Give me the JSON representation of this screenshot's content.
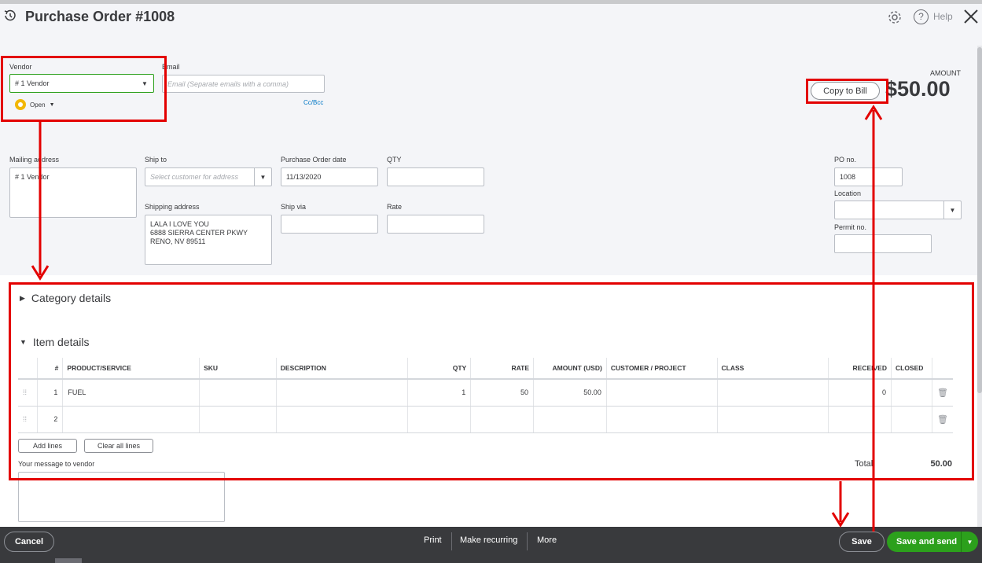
{
  "header": {
    "title": "Purchase Order #1008",
    "help_label": "Help",
    "amount_label": "AMOUNT",
    "amount_value": "$50.00",
    "copy_button": "Copy to Bill"
  },
  "vendor": {
    "label": "Vendor",
    "value": "# 1 Vendor",
    "status": "Open"
  },
  "email": {
    "label": "Email",
    "placeholder": "Email (Separate emails with a comma)",
    "cc_bcc": "Cc/Bcc"
  },
  "mailing": {
    "label": "Mailing address",
    "value": "# 1 Vendor"
  },
  "ship_to": {
    "label": "Ship to",
    "placeholder": "Select customer for address"
  },
  "shipping_address": {
    "label": "Shipping address",
    "value": "LALA I LOVE YOU\n6888 SIERRA CENTER PKWY\nRENO, NV  89511"
  },
  "po_date": {
    "label": "Purchase Order date",
    "value": "11/13/2020"
  },
  "ship_via": {
    "label": "Ship via",
    "value": ""
  },
  "qty_field": {
    "label": "QTY",
    "value": ""
  },
  "rate_field": {
    "label": "Rate",
    "value": ""
  },
  "po_no": {
    "label": "PO no.",
    "value": "1008"
  },
  "location": {
    "label": "Location",
    "value": ""
  },
  "permit": {
    "label": "Permit no.",
    "value": ""
  },
  "sections": {
    "category": "Category details",
    "items": "Item details"
  },
  "table": {
    "columns": [
      "#",
      "PRODUCT/SERVICE",
      "SKU",
      "DESCRIPTION",
      "QTY",
      "RATE",
      "AMOUNT (USD)",
      "CUSTOMER / PROJECT",
      "CLASS",
      "RECEIVED",
      "CLOSED"
    ],
    "rows": [
      {
        "num": "1",
        "product": "FUEL",
        "sku": "",
        "description": "",
        "qty": "1",
        "rate": "50",
        "amount": "50.00",
        "customer": "",
        "class": "",
        "received": "0",
        "closed": ""
      },
      {
        "num": "2",
        "product": "",
        "sku": "",
        "description": "",
        "qty": "",
        "rate": "",
        "amount": "",
        "customer": "",
        "class": "",
        "received": "",
        "closed": ""
      }
    ]
  },
  "buttons": {
    "add_lines": "Add lines",
    "clear_all": "Clear all lines"
  },
  "message": {
    "label": "Your message to vendor"
  },
  "total": {
    "label": "Total",
    "value": "50.00"
  },
  "footer": {
    "cancel": "Cancel",
    "print": "Print",
    "make_recurring": "Make recurring",
    "more": "More",
    "save": "Save",
    "save_and_send": "Save and send"
  },
  "colors": {
    "annotation": "#e30000",
    "primary_green": "#2ca01c",
    "footer_bg": "#393a3d"
  }
}
